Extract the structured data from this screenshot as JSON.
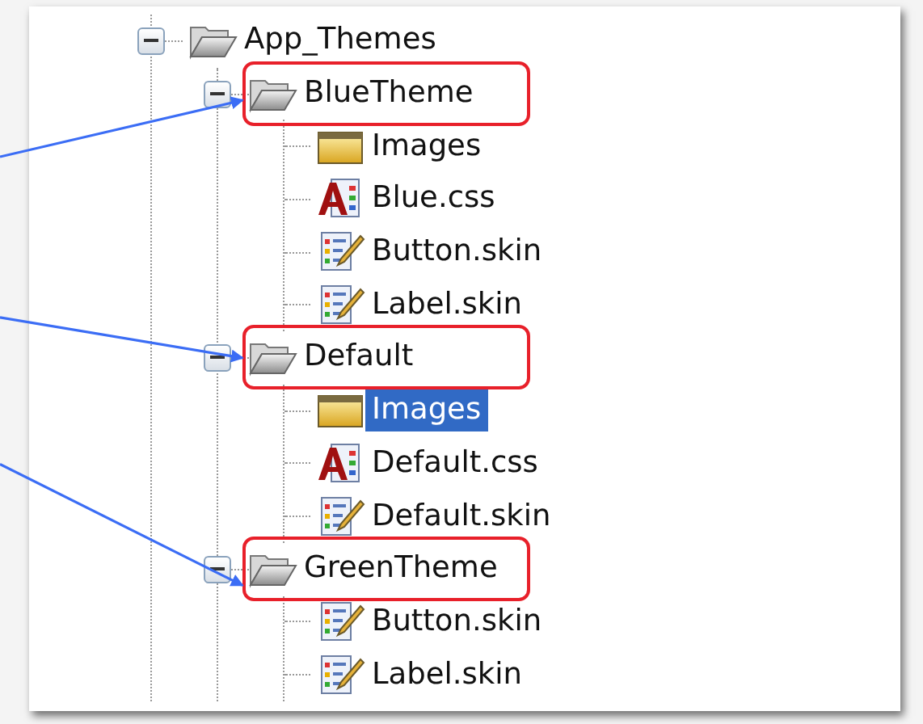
{
  "tree": [
    {
      "label": "App_Themes",
      "kind": "folder",
      "expanded": true,
      "highlighted": false,
      "selected": false,
      "children": [
        {
          "label": "BlueTheme",
          "kind": "folder",
          "expanded": true,
          "highlighted": true,
          "selected": false,
          "children": [
            {
              "label": "Images",
              "kind": "folder",
              "highlighted": false,
              "selected": false
            },
            {
              "label": "Blue.css",
              "kind": "css",
              "highlighted": false,
              "selected": false
            },
            {
              "label": "Button.skin",
              "kind": "skin",
              "highlighted": false,
              "selected": false
            },
            {
              "label": "Label.skin",
              "kind": "skin",
              "highlighted": false,
              "selected": false
            }
          ]
        },
        {
          "label": "Default",
          "kind": "folder",
          "expanded": true,
          "highlighted": true,
          "selected": false,
          "children": [
            {
              "label": "Images",
              "kind": "folder",
              "highlighted": false,
              "selected": true
            },
            {
              "label": "Default.css",
              "kind": "css",
              "highlighted": false,
              "selected": false
            },
            {
              "label": "Default.skin",
              "kind": "skin",
              "highlighted": false,
              "selected": false
            }
          ]
        },
        {
          "label": "GreenTheme",
          "kind": "folder",
          "expanded": true,
          "highlighted": true,
          "selected": false,
          "children": [
            {
              "label": "Button.skin",
              "kind": "skin",
              "highlighted": false,
              "selected": false
            },
            {
              "label": "Label.skin",
              "kind": "skin",
              "highlighted": false,
              "selected": false
            }
          ]
        }
      ]
    }
  ]
}
